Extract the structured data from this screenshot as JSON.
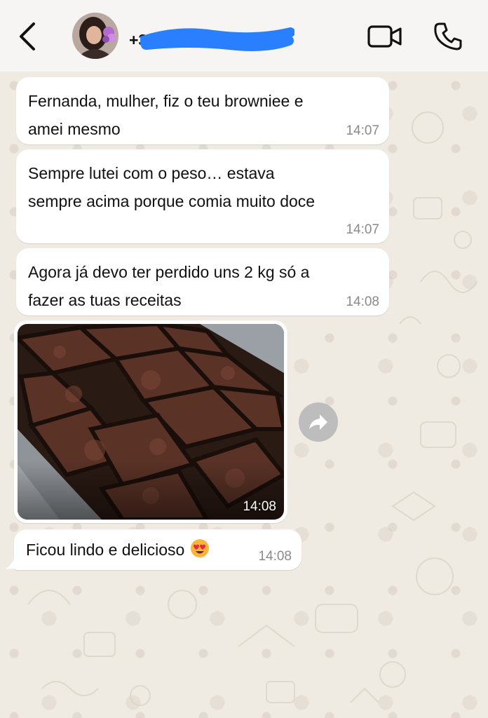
{
  "header": {
    "contact_name": "+3",
    "colors": {
      "bar": "#f6f5f3",
      "redaction": "#2a7fff"
    }
  },
  "messages": [
    {
      "text": "Fernanda, mulher, fiz o teu browniee e\namei mesmo",
      "time": "14:07"
    },
    {
      "text": "Sempre lutei com o peso… estava\nsempre acima porque comia muito doce",
      "time": "14:07"
    },
    {
      "text": "Agora já devo ter perdido uns 2 kg só a\nfazer as tuas receitas",
      "time": "14:08"
    },
    {
      "type": "image",
      "subject": "brownie squares in a baking tray",
      "time": "14:08"
    },
    {
      "text": "Ficou lindo e delicioso",
      "emoji": "smiling-face-with-heart-eyes",
      "time": "14:08"
    }
  ],
  "icons": {
    "back": "chevron-left-icon",
    "video": "video-camera-icon",
    "call": "phone-icon",
    "forward": "forward-share-icon"
  }
}
